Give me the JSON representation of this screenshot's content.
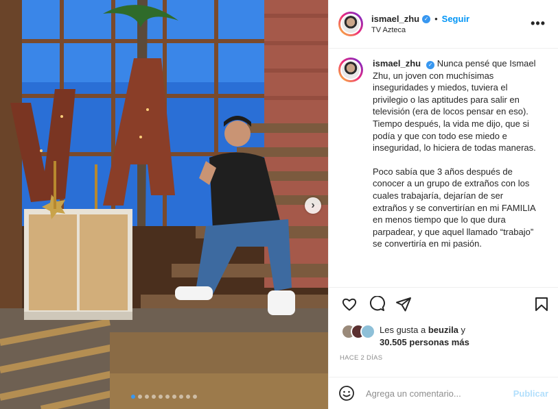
{
  "post": {
    "username": "ismael_zhu",
    "follow_label": "Seguir",
    "separator": "•",
    "location": "TV Azteca",
    "more_label": "•••",
    "caption_paragraphs": [
      "Nunca pensé que Ismael Zhu, un joven con muchísimas inseguridades y miedos, tuviera el privilegio o las aptitudes para salir en televisión (era de locos pensar en eso).",
      "Tiempo después, la vida me dijo, que si podía y que con todo ese miedo e inseguridad, lo hiciera de todas maneras.",
      "Poco sabía que 3 años después de conocer a un grupo de extraños con los cuales trabajaría, dejarían de ser extraños y se convertirían en mi FAMILIA en menos tiempo que lo que dura parpadear, y que aquel llamado “trabajo” se convertiría en mi pasión."
    ],
    "likes_prefix": "Les gusta a",
    "likes_user": "beuzila",
    "likes_and": "y",
    "likes_count": "30.505 personas más",
    "time": "HACE 2 DÍAS",
    "comment_placeholder": "Agrega un comentario...",
    "publish_label": "Publicar"
  },
  "carousel": {
    "total": 10,
    "active_index": 0,
    "next_label": "›"
  },
  "icons": [
    "heart-icon",
    "comment-icon",
    "share-icon",
    "bookmark-icon",
    "emoji-icon",
    "verified-icon"
  ],
  "colors": {
    "accent": "#0095f6",
    "text": "#262626",
    "muted": "#8e8e8e",
    "publish_disabled": "#b2dffc",
    "active_dot": "#3897f0"
  }
}
